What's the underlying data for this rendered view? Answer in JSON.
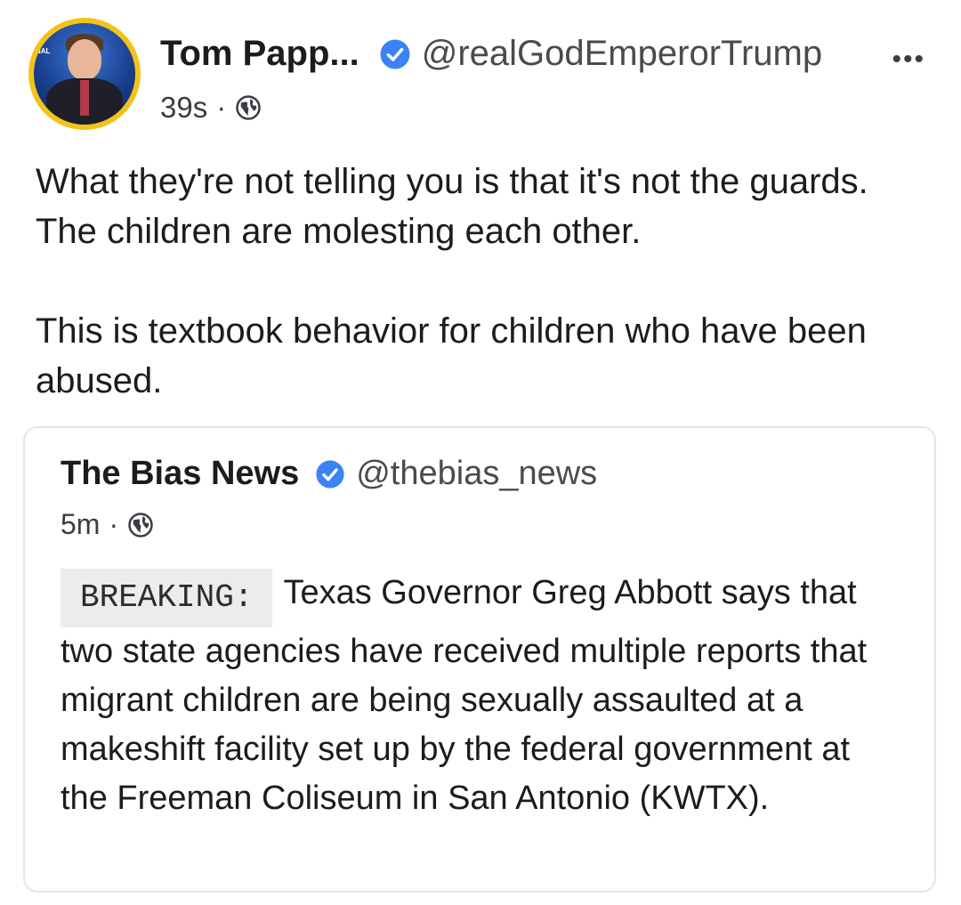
{
  "post": {
    "author": {
      "display_name": "Tom Papp...",
      "handle": "@realGodEmperorTrump",
      "verified": true,
      "avatar_logo_text": "NAL"
    },
    "timestamp": "39s",
    "separator": "·",
    "visibility_icon": "globe-icon",
    "more_icon": "ellipsis-icon",
    "more_label": "•••",
    "paragraphs": [
      "What they're not telling you is that it's not the guards. The children are molesting each other.",
      "This is textbook behavior for children who have been abused."
    ]
  },
  "quoted_post": {
    "author": {
      "display_name": "The Bias News",
      "handle": "@thebias_news",
      "verified": true
    },
    "timestamp": "5m",
    "separator": "·",
    "visibility_icon": "globe-icon",
    "code_tag": "BREAKING:",
    "body": "Texas Governor Greg Abbott says that two state agencies have received multiple reports that migrant children are being sexually assaulted at a makeshift facility set up by the federal government at the Freeman Coliseum in San Antonio (KWTX)."
  },
  "colors": {
    "verified_badge": "#3b82f6",
    "avatar_ring": "#f2c31a",
    "card_border": "#e5e5ea",
    "code_background": "#ececec"
  }
}
